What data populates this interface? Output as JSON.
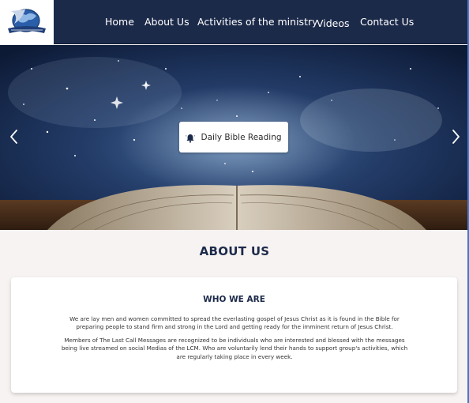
{
  "nav": {
    "items": [
      {
        "label": "Home"
      },
      {
        "label": "About Us"
      },
      {
        "label": "Activities of the ministry"
      },
      {
        "label": "Videos"
      },
      {
        "label": "Contact Us"
      }
    ]
  },
  "hero": {
    "button_label": "Daily Bible Reading",
    "icons": {
      "prev": "chevron-left-icon",
      "next": "chevron-right-icon",
      "bell": "bell-icon"
    }
  },
  "about": {
    "title": "ABOUT US",
    "card_title": "WHO WE ARE",
    "paragraph1": "We are lay men and women committed to spread the everlasting gospel of Jesus Christ as it is found in the Bible for preparing people to stand firm and strong in the Lord and getting ready for the imminent return of Jesus Christ.",
    "paragraph2": "Members of The Last Call Messages are recognized to be individuals who are interested and blessed with the messages being live streamed on social Medias of the LCM.  Who are voluntarily lend their hands to support group's activities, which are regularly taking place in every week."
  },
  "colors": {
    "navbar": "#1c2a4a",
    "accent": "#1c2a4a",
    "background": "#f7f3f2"
  }
}
